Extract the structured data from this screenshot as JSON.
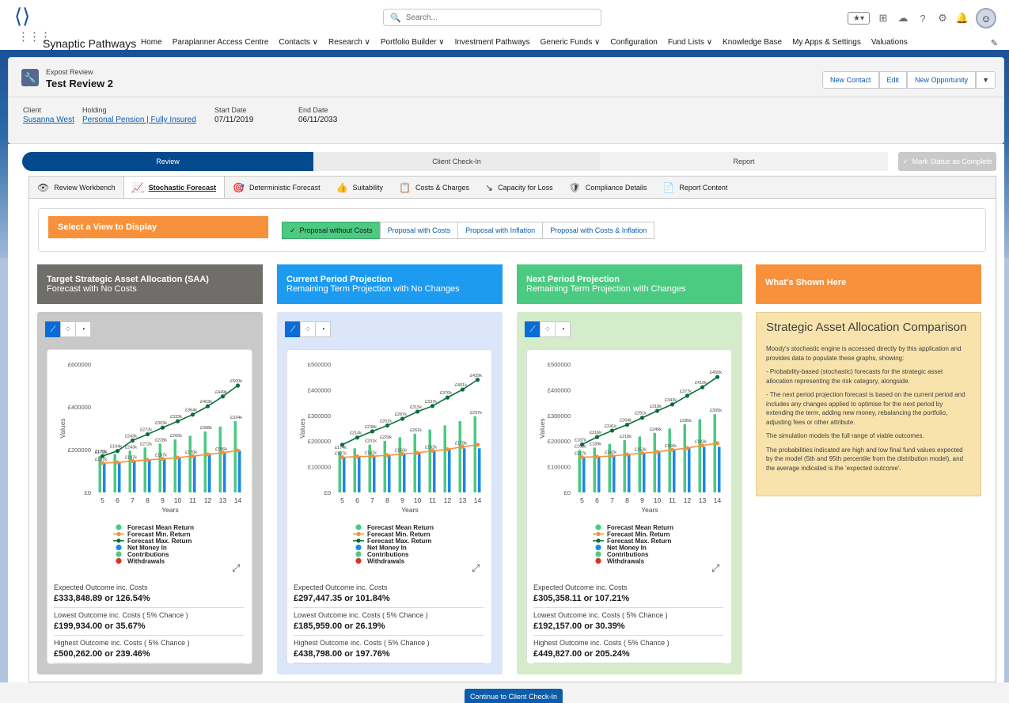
{
  "header": {
    "search_placeholder": "Search...",
    "app_name": "Synaptic Pathways",
    "nav": [
      "Home",
      "Paraplanner Access Centre",
      "Contacts ∨",
      "Research ∨",
      "Portfolio Builder ∨",
      "Investment Pathways",
      "Generic Funds ∨",
      "Configuration",
      "Fund Lists ∨",
      "Knowledge Base",
      "My Apps & Settings",
      "Valuations"
    ]
  },
  "record": {
    "object": "Expost Review",
    "title": "Test Review 2",
    "buttons": {
      "new_contact": "New Contact",
      "edit": "Edit",
      "new_opportunity": "New Opportunity"
    },
    "fields": {
      "client_label": "Client",
      "client_value": "Susanna West",
      "holding_label": "Holding",
      "holding_value": "Personal Pension | Fully Insured",
      "start_label": "Start Date",
      "start_value": "07/11/2019",
      "end_label": "End Date",
      "end_value": "06/11/2033"
    }
  },
  "path": {
    "steps": [
      "Review",
      "Client Check-In",
      "Report"
    ],
    "mark_complete": "Mark Status as Complete"
  },
  "tabs": [
    "Review Workbench",
    "Stochastic Forecast",
    "Deterministic Forecast",
    "Suitability",
    "Costs & Charges",
    "Capacity for Loss",
    "Compliance Details",
    "Report Content"
  ],
  "view_select": {
    "label": "Select a View to Display",
    "options": [
      "Proposal without Costs",
      "Proposal with Costs",
      "Proposal with Inflation",
      "Proposal with Costs & Inflation"
    ],
    "selected": "Proposal without Costs"
  },
  "columns": [
    {
      "title": "Target Strategic Asset Allocation (SAA)",
      "subtitle": "Forecast with No Costs",
      "color": "#706e6b",
      "body": "#c9c9c9",
      "stats": [
        [
          "Expected Outcome inc. Costs",
          "£333,848.89 or 126.54%"
        ],
        [
          "Lowest Outcome inc. Costs ( 5% Chance )",
          "£199,934.00 or 35.67%"
        ],
        [
          "Highest Outcome inc. Costs ( 5% Chance )",
          "£500,262.00 or 239.46%"
        ]
      ]
    },
    {
      "title": "Current Period Projection",
      "subtitle": "Remaining Term Projection with No Changes",
      "color": "#1d9bf0",
      "body": "#dbe6fb",
      "stats": [
        [
          "Expected Outcome inc. Costs",
          "£297,447.35 or 101.84%"
        ],
        [
          "Lowest Outcome inc. Costs ( 5% Chance )",
          "£185,959.00 or 26.19%"
        ],
        [
          "Highest Outcome inc. Costs ( 5% Chance )",
          "£438,798.00 or 197.76%"
        ]
      ]
    },
    {
      "title": "Next Period Projection",
      "subtitle": "Remaining Term Projection with Changes",
      "color": "#4bca81",
      "body": "#d4ecc9",
      "stats": [
        [
          "Expected Outcome inc. Costs",
          "£305,358.11 or 107.21%"
        ],
        [
          "Lowest Outcome inc. Costs ( 5% Chance )",
          "£192,157.00 or 30.39%"
        ],
        [
          "Highest Outcome inc. Costs ( 5% Chance )",
          "£449,827.00 or 205.24%"
        ]
      ]
    }
  ],
  "info": {
    "header": "What's Shown Here",
    "title": "Strategic Asset Allocation Comparison",
    "paragraphs": [
      "Moody's stochastic engine is accessed directly by this application and provides data to populate these graphs, showing:",
      "- Probability-based (stochastic) forecasts for the strategic asset allocation representing the risk category, alongside.",
      "- The next period projection forecast is based on the current period and includes any changes applied to optimise for the next period by extending the term, adding new money, rebalancing the portfolio, adjusting fees or other attribute.",
      "The simulation models the full range of viable outcomes.",
      "The probabilities indicated are high and low final fund values expected by the model (5th and 95th percentile from the distribution model), and the average indicated is the 'expected outcome'."
    ]
  },
  "continue_button": "Continue to Client Check-In",
  "chart_data": [
    {
      "type": "bar",
      "title": "",
      "xlabel": "Years",
      "ylabel": "Values",
      "x": [
        5,
        6,
        7,
        8,
        9,
        10,
        11,
        12,
        13,
        14
      ],
      "ylim": [
        0,
        600000
      ],
      "yticks": [
        "£0",
        "£200000",
        "£400000",
        "£600000"
      ],
      "series": [
        {
          "name": "Forecast Mean Return",
          "kind": "bar",
          "color": "#4bca81",
          "values": [
            170000,
            180000,
            195000,
            210000,
            228000,
            248000,
            265000,
            285000,
            308000,
            334000
          ]
        },
        {
          "name": "Forecast Min. Return",
          "kind": "line",
          "color": "#f7913b",
          "values": [
            137000,
            140000,
            147000,
            152000,
            157000,
            163000,
            170000,
            178000,
            186000,
            196000
          ]
        },
        {
          "name": "Forecast Max. Return",
          "kind": "line",
          "color": "#0b6e3a",
          "values": [
            170000,
            194000,
            243000,
            272000,
            303000,
            333000,
            364000,
            403000,
            449000,
            500000
          ]
        },
        {
          "name": "Net Money In",
          "kind": "bar",
          "color": "#1e88e5",
          "values": [
            137000,
            140000,
            147000,
            152000,
            157000,
            163000,
            170000,
            178000,
            186000,
            196000
          ]
        },
        {
          "name": "Contributions",
          "kind": "legend",
          "color": "#4bca81"
        },
        {
          "name": "Withdrawals",
          "kind": "legend",
          "color": "#d93025"
        }
      ],
      "bar_labels": [
        "£170k",
        "",
        "£243k",
        "£272k",
        "£228k",
        "£265k",
        "",
        "£308k",
        "",
        "£334k"
      ],
      "max_labels": [
        "£170k",
        "£194k",
        "£243k",
        "£272k",
        "£303k",
        "£333k",
        "£364k",
        "£403k",
        "£449k",
        "£500k"
      ],
      "min_labels": [
        "£137k",
        "",
        "£147k",
        "",
        "£157k",
        "",
        "£170k",
        "",
        "£196k",
        ""
      ]
    },
    {
      "type": "bar",
      "title": "",
      "xlabel": "Years",
      "ylabel": "Values",
      "x": [
        5,
        6,
        7,
        8,
        9,
        10,
        11,
        12,
        13,
        14
      ],
      "ylim": [
        0,
        500000
      ],
      "yticks": [
        "£0",
        "£100000",
        "£200000",
        "£300000",
        "£400000",
        "£500000"
      ],
      "series": [
        {
          "name": "Forecast Mean Return",
          "kind": "bar",
          "color": "#4bca81",
          "values": [
            160000,
            172000,
            186000,
            201000,
            215000,
            229000,
            245000,
            261000,
            278000,
            297000
          ]
        },
        {
          "name": "Forecast Min. Return",
          "kind": "line",
          "color": "#f7913b",
          "values": [
            137000,
            140000,
            141000,
            145000,
            150000,
            154000,
            162000,
            168000,
            178000,
            186000
          ]
        },
        {
          "name": "Forecast Max. Return",
          "kind": "line",
          "color": "#0b6e3a",
          "values": [
            186000,
            214000,
            238000,
            261000,
            287000,
            315000,
            337000,
            370000,
            401000,
            439000
          ]
        },
        {
          "name": "Net Money In",
          "kind": "bar",
          "color": "#1e88e5",
          "values": [
            137000,
            140000,
            141000,
            145000,
            150000,
            154000,
            162000,
            168000,
            172000,
            172000
          ]
        },
        {
          "name": "Contributions",
          "kind": "legend",
          "color": "#4bca81"
        },
        {
          "name": "Withdrawals",
          "kind": "legend",
          "color": "#d93025"
        }
      ],
      "bar_labels": [
        "£174k",
        "",
        "£201k",
        "£229k",
        "",
        "£261k",
        "",
        "",
        "",
        "£297k"
      ],
      "max_labels": [
        "",
        "£214k",
        "£238k",
        "£261k",
        "£287k",
        "£315k",
        "£337k",
        "£370k",
        "£401k",
        "£439k"
      ],
      "min_labels": [
        "£137k",
        "",
        "£141k",
        "",
        "£150k",
        "",
        "£162k",
        "",
        "£178k",
        ""
      ]
    },
    {
      "type": "bar",
      "title": "",
      "xlabel": "Years",
      "ylabel": "Values",
      "x": [
        5,
        6,
        7,
        8,
        9,
        10,
        11,
        12,
        13,
        14
      ],
      "ylim": [
        0,
        500000
      ],
      "yticks": [
        "£0",
        "£100000",
        "£200000",
        "£300000",
        "£400000",
        "£500000"
      ],
      "series": [
        {
          "name": "Forecast Mean Return",
          "kind": "bar",
          "color": "#4bca81",
          "values": [
            165000,
            175000,
            189000,
            204000,
            218000,
            232000,
            249000,
            266000,
            285000,
            305000
          ]
        },
        {
          "name": "Forecast Min. Return",
          "kind": "line",
          "color": "#f7913b",
          "values": [
            137000,
            139000,
            142000,
            148000,
            153000,
            158000,
            166000,
            173000,
            183000,
            192000
          ]
        },
        {
          "name": "Forecast Max. Return",
          "kind": "line",
          "color": "#0b6e3a",
          "values": [
            187000,
            216000,
            241000,
            264000,
            291000,
            318000,
            343000,
            377000,
            410000,
            450000
          ]
        },
        {
          "name": "Net Money In",
          "kind": "bar",
          "color": "#1e88e5",
          "values": [
            137000,
            139000,
            142000,
            148000,
            153000,
            158000,
            166000,
            173000,
            178000,
            178000
          ]
        },
        {
          "name": "Contributions",
          "kind": "legend",
          "color": "#4bca81"
        },
        {
          "name": "Withdrawals",
          "kind": "legend",
          "color": "#d93025"
        }
      ],
      "bar_labels": [
        "£168k",
        "£189k",
        "",
        "£218k",
        "",
        "£249k",
        "",
        "£285k",
        "",
        "£305k"
      ],
      "max_labels": [
        "£187k",
        "£216k",
        "£241k",
        "£264k",
        "£291k",
        "£318k",
        "£343k",
        "£377k",
        "£410k",
        "£450k"
      ],
      "min_labels": [
        "£137k",
        "",
        "£142k",
        "",
        "£153k",
        "",
        "£166k",
        "",
        "£183k",
        ""
      ]
    }
  ]
}
